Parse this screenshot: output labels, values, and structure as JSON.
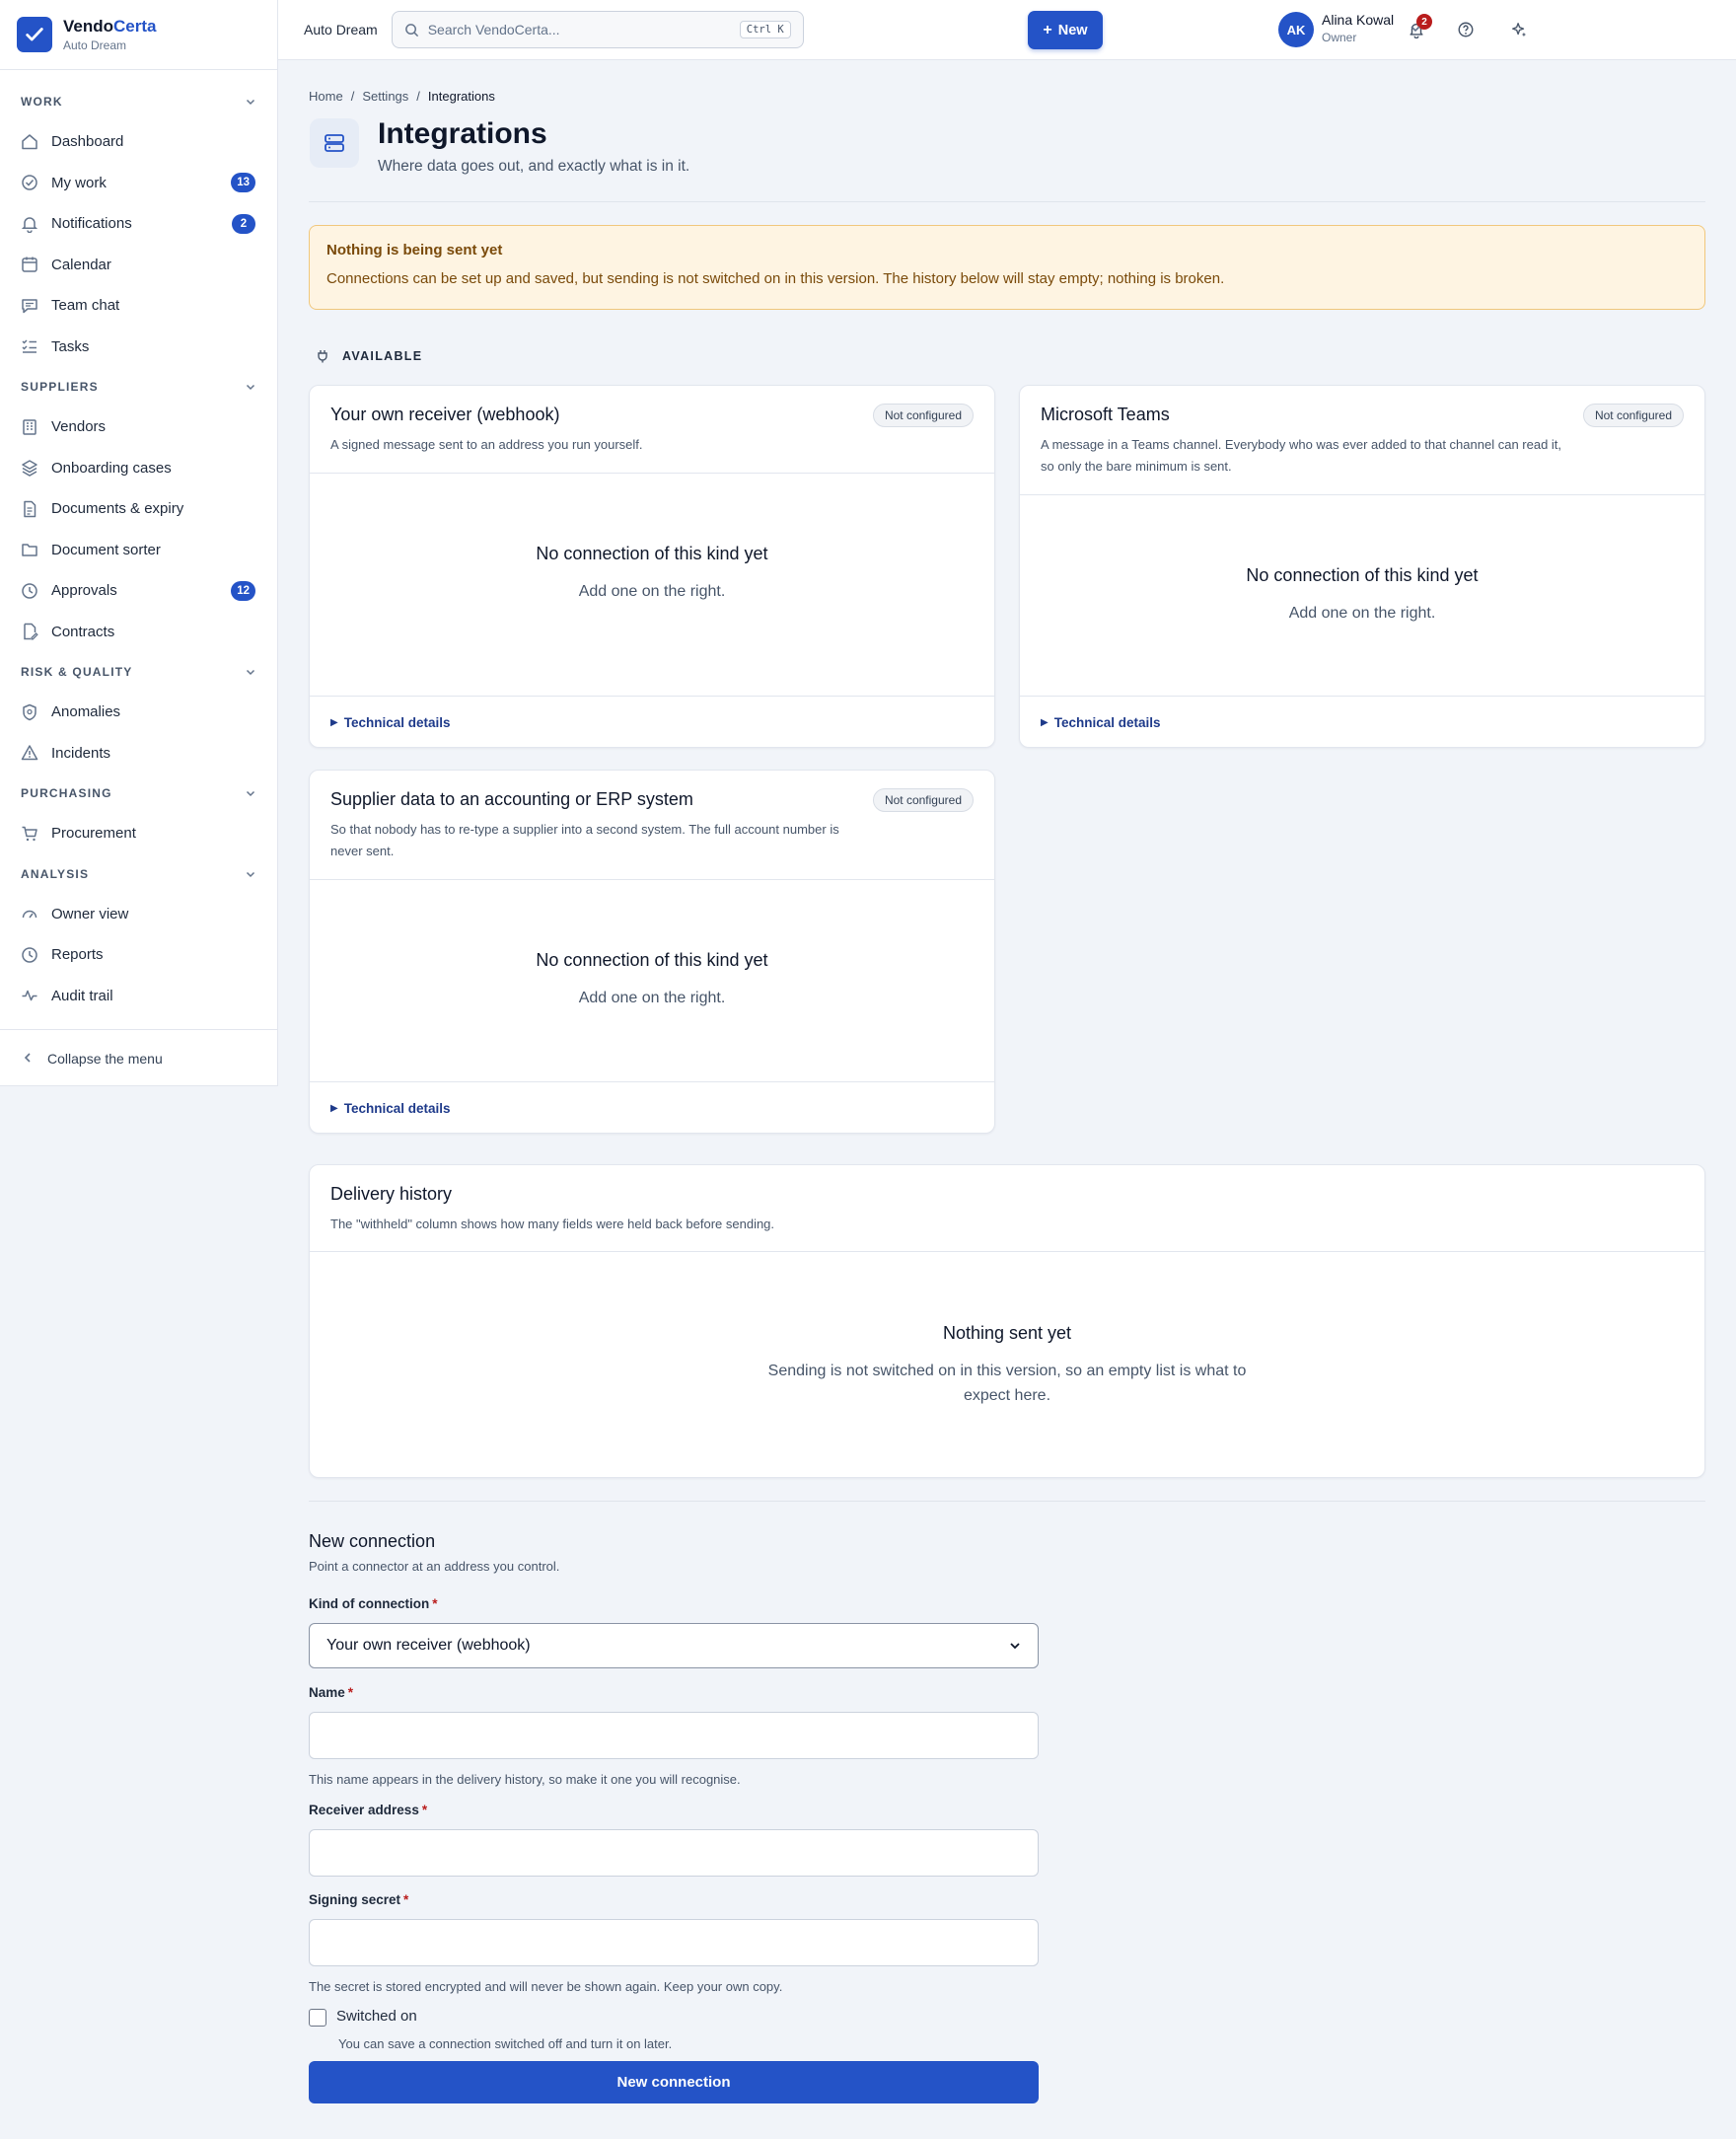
{
  "brand": {
    "name_part1": "Vendo",
    "name_part2": "Certa",
    "org": "Auto Dream"
  },
  "sidebar": {
    "sections": [
      {
        "title": "WORK",
        "items": [
          {
            "label": "Dashboard",
            "icon": "home-icon"
          },
          {
            "label": "My work",
            "icon": "check-circle-icon",
            "badge": "13"
          },
          {
            "label": "Notifications",
            "icon": "bell-icon",
            "badge": "2"
          },
          {
            "label": "Calendar",
            "icon": "calendar-icon"
          },
          {
            "label": "Team chat",
            "icon": "chat-icon"
          },
          {
            "label": "Tasks",
            "icon": "list-check-icon"
          }
        ]
      },
      {
        "title": "SUPPLIERS",
        "items": [
          {
            "label": "Vendors",
            "icon": "building-icon"
          },
          {
            "label": "Onboarding cases",
            "icon": "layers-icon"
          },
          {
            "label": "Documents & expiry",
            "icon": "document-icon"
          },
          {
            "label": "Document sorter",
            "icon": "folder-icon"
          },
          {
            "label": "Approvals",
            "icon": "clock-icon",
            "badge": "12"
          },
          {
            "label": "Contracts",
            "icon": "contract-icon"
          }
        ]
      },
      {
        "title": "RISK & QUALITY",
        "items": [
          {
            "label": "Anomalies",
            "icon": "shield-icon"
          },
          {
            "label": "Incidents",
            "icon": "warning-icon"
          }
        ]
      },
      {
        "title": "PURCHASING",
        "items": [
          {
            "label": "Procurement",
            "icon": "cart-icon"
          }
        ]
      },
      {
        "title": "ANALYSIS",
        "items": [
          {
            "label": "Owner view",
            "icon": "gauge-icon"
          },
          {
            "label": "Reports",
            "icon": "clock-icon"
          },
          {
            "label": "Audit trail",
            "icon": "activity-icon"
          }
        ]
      }
    ],
    "collapse_label": "Collapse the menu"
  },
  "topbar": {
    "org": "Auto Dream",
    "search_placeholder": "Search VendoCerta...",
    "search_shortcut": "Ctrl K",
    "new_label": "New",
    "bell_count": "2",
    "avatar_initials": "AK",
    "user_name": "Alina Kowal",
    "user_role": "Owner"
  },
  "breadcrumb": {
    "home": "Home",
    "settings": "Settings",
    "current": "Integrations"
  },
  "page": {
    "title": "Integrations",
    "subtitle": "Where data goes out, and exactly what is in it."
  },
  "alert": {
    "title": "Nothing is being sent yet",
    "text": "Connections can be set up and saved, but sending is not switched on in this version. The history below will stay empty; nothing is broken."
  },
  "available_heading": "AVAILABLE",
  "connectors": [
    {
      "title": "Your own receiver (webhook)",
      "desc": "A signed message sent to an address you run yourself.",
      "status": "Not configured"
    },
    {
      "title": "Microsoft Teams",
      "desc": "A message in a Teams channel. Everybody who was ever added to that channel can read it, so only the bare minimum is sent.",
      "status": "Not configured"
    },
    {
      "title": "Supplier data to an accounting or ERP system",
      "desc": "So that nobody has to re-type a supplier into a second system. The full account number is never sent.",
      "status": "Not configured"
    }
  ],
  "connector_empty": {
    "title": "No connection of this kind yet",
    "sub": "Add one on the right."
  },
  "tech_details": "Technical details",
  "history": {
    "title": "Delivery history",
    "desc": "The \"withheld\" column shows how many fields were held back before sending.",
    "empty_title": "Nothing sent yet",
    "empty_sub": "Sending is not switched on in this version, so an empty list is what to expect here."
  },
  "form": {
    "title": "New connection",
    "subtitle": "Point a connector at an address you control.",
    "kind_label": "Kind of connection",
    "kind_value": "Your own receiver (webhook)",
    "name_label": "Name",
    "name_hint": "This name appears in the delivery history, so make it one you will recognise.",
    "address_label": "Receiver address",
    "secret_label": "Signing secret",
    "secret_hint": "The secret is stored encrypted and will never be shown again. Keep your own copy.",
    "switch_label": "Switched on",
    "switch_hint": "You can save a connection switched off and turn it on later.",
    "submit_label": "New connection",
    "required_mark": "*"
  }
}
